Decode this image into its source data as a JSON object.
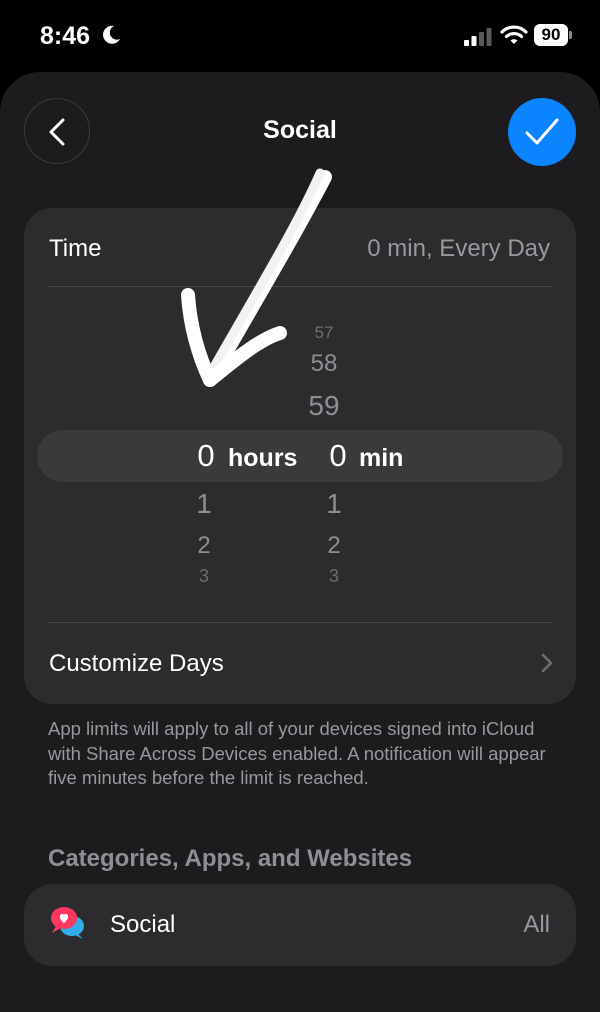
{
  "status_bar": {
    "time": "8:46",
    "battery": "90"
  },
  "header": {
    "title": "Social"
  },
  "time_row": {
    "label": "Time",
    "value": "0 min, Every Day"
  },
  "picker": {
    "hours": {
      "above": [
        "",
        "",
        ""
      ],
      "selected": "0",
      "below": [
        "1",
        "2",
        "3"
      ],
      "unit": "hours"
    },
    "minutes": {
      "above": [
        "57",
        "58",
        "59"
      ],
      "selected": "0",
      "below": [
        "1",
        "2",
        "3"
      ],
      "unit": "min"
    }
  },
  "customize_days": {
    "label": "Customize Days"
  },
  "note": "App limits will apply to all of your devices signed into iCloud with Share Across Devices enabled. A notification will appear five minutes before the limit is reached.",
  "section": {
    "title": "Categories, Apps, and Websites"
  },
  "category": {
    "label": "Social",
    "value": "All",
    "icon": "social-bubbles-icon"
  },
  "colors": {
    "accent": "#0a84ff",
    "card": "#2c2c2e",
    "sheet": "#1c1c1e"
  }
}
